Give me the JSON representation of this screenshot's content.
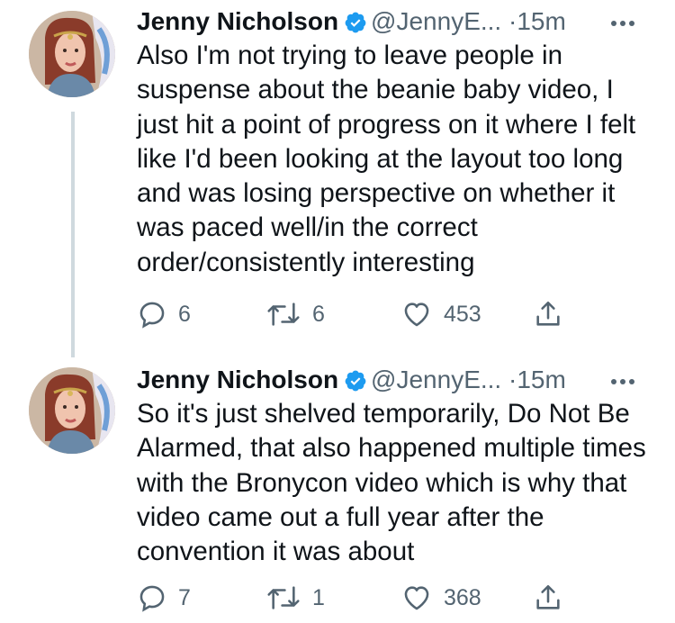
{
  "tweets": [
    {
      "author_name": "Jenny Nicholson",
      "handle": "@JennyE...",
      "separator": "·",
      "time": "15m",
      "text": "Also I'm not trying to leave people in suspense about the beanie baby video, I just hit a point of progress on it where I felt like I'd been looking at the layout too long and was losing perspective on whether it was paced well/in the correct order/consistently interesting",
      "replies": "6",
      "retweets": "6",
      "likes": "453"
    },
    {
      "author_name": "Jenny Nicholson",
      "handle": "@JennyE...",
      "separator": "·",
      "time": "15m",
      "text": "So it's just shelved temporarily, Do Not Be Alarmed, that also happened multiple times with the Bronycon video which is why that video came out a full year after the convention it was about",
      "replies": "7",
      "retweets": "1",
      "likes": "368"
    }
  ],
  "icons": {
    "verified": "verified-badge-icon",
    "more": "more-options-icon",
    "reply": "reply-icon",
    "retweet": "retweet-icon",
    "like": "heart-icon",
    "share": "share-icon"
  },
  "colors": {
    "verified": "#1d9bf0",
    "secondary_text": "#536471",
    "thread_line": "#cfd9de"
  }
}
